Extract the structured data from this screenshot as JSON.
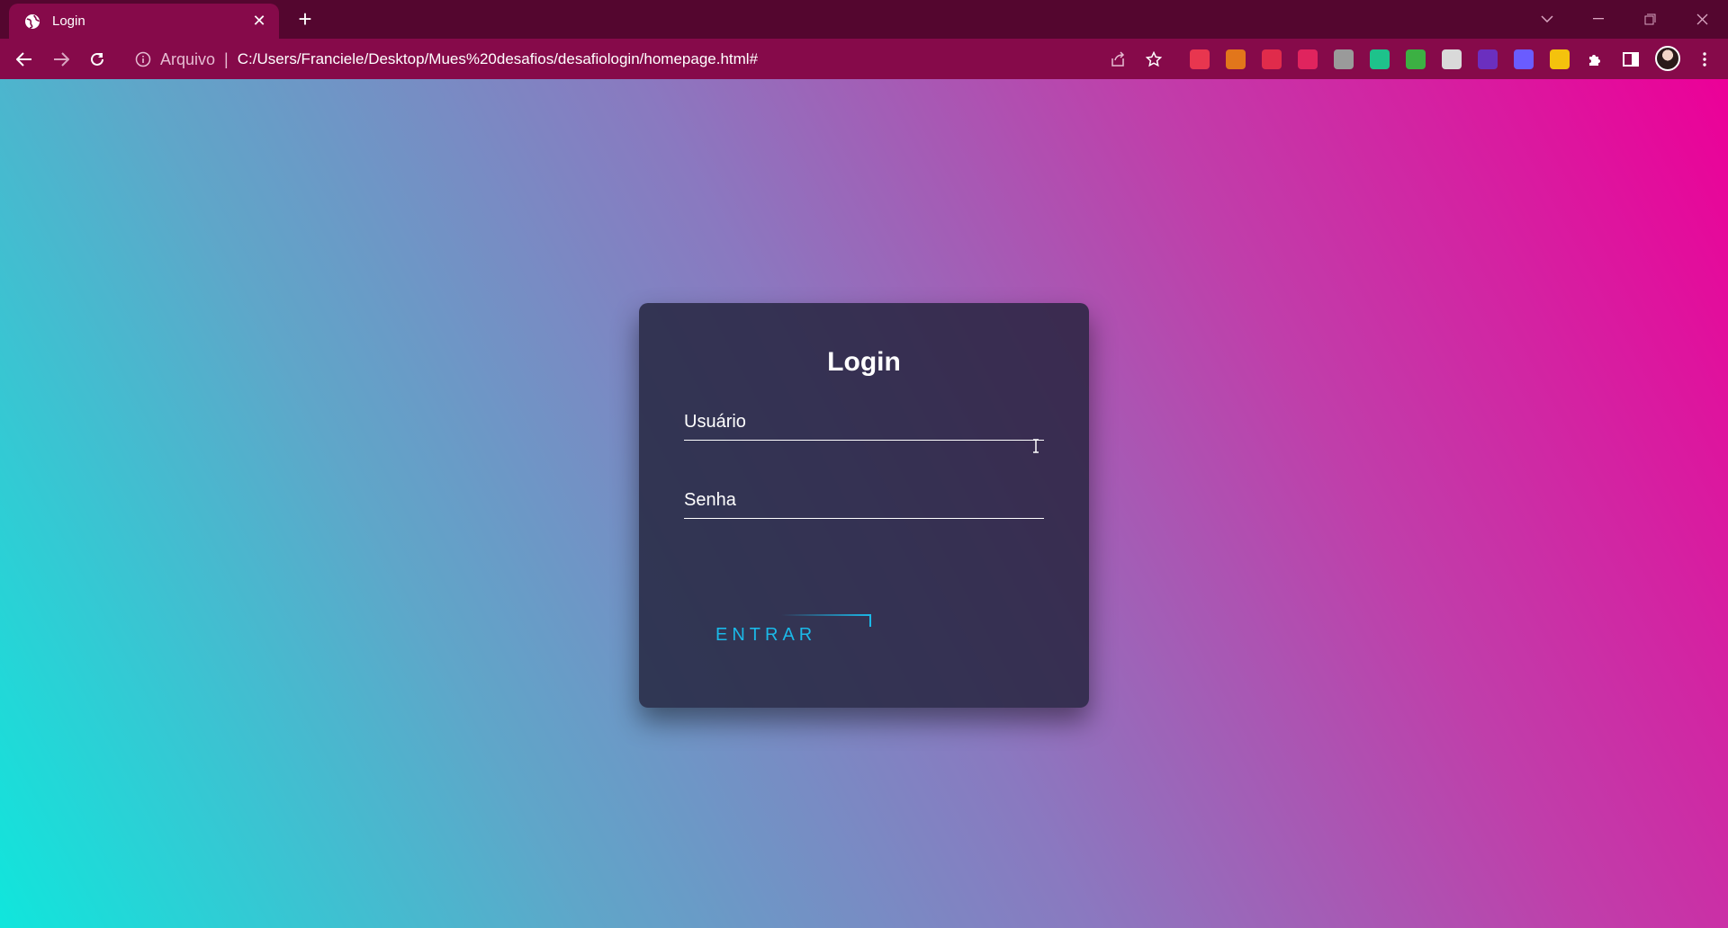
{
  "browser": {
    "tab_title": "Login",
    "new_tab_symbol": "+",
    "tab_close_symbol": "✕",
    "omnibox": {
      "scheme_label": "Arquivo",
      "separator": "|",
      "url": "C:/Users/Franciele/Desktop/Mues%20desafios/desafiologin/homepage.html#"
    },
    "extensions": [
      {
        "name": "ext-red-grid-icon",
        "color": "#e8364f"
      },
      {
        "name": "ext-fox-icon",
        "color": "#e2761b"
      },
      {
        "name": "ext-m-icon",
        "color": "#e02b4b"
      },
      {
        "name": "ext-person-icon",
        "color": "#e0245e"
      },
      {
        "name": "ext-pen-icon",
        "color": "#9a9a9a"
      },
      {
        "name": "ext-hook-icon",
        "color": "#1ec28b"
      },
      {
        "name": "ext-stack-icon",
        "color": "#3cb043"
      },
      {
        "name": "ext-gear-icon",
        "color": "#d9d9d9"
      },
      {
        "name": "ext-video-icon",
        "color": "#6b2fbf"
      },
      {
        "name": "ext-flower-icon",
        "color": "#6a5cff"
      },
      {
        "name": "ext-w-icon",
        "color": "#f4c20d"
      }
    ]
  },
  "login": {
    "title": "Login",
    "username_placeholder": "Usuário",
    "password_placeholder": "Senha",
    "submit_label": "ENTRAR",
    "accent_color": "#1bb9e8"
  }
}
